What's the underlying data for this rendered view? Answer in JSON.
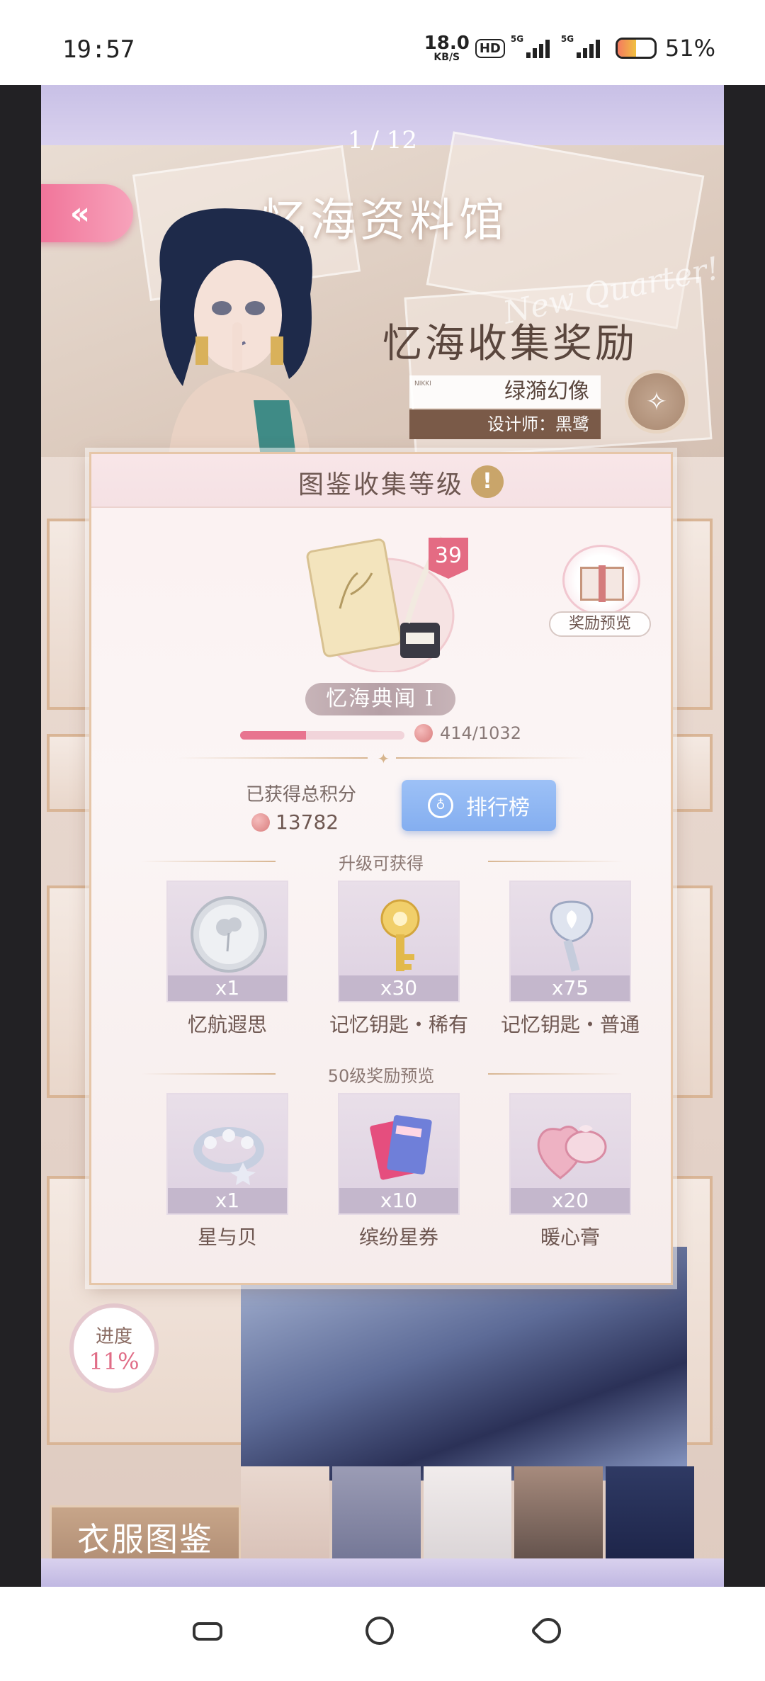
{
  "status_bar": {
    "time": "19:57",
    "net_speed_value": "18.0",
    "net_speed_unit": "KB/S",
    "hd_label": "HD",
    "sig1_label": "5G",
    "sig2_label": "5G",
    "battery_percent": "51%",
    "battery_level": 0.51
  },
  "game": {
    "page_indicator": "1 / 12",
    "back_icon": "double-chevron-left-icon",
    "title": "忆海资料馆",
    "banner": {
      "watermark": "New Quarter!",
      "title": "忆海收集奖励",
      "outfit_tag": "NIKKI",
      "outfit_name": "绿漪幻像",
      "designer": "设计师：黑鹭"
    },
    "background_cards": {
      "card_label": "衣服图鉴",
      "progress_label": "进度",
      "progress_value": "11%",
      "progress_level": 0.11
    }
  },
  "modal": {
    "title": "图鉴收集等级",
    "info_icon": "!",
    "level": "39",
    "reward_preview_label": "奖励预览",
    "rank_name": "忆海典闻 I",
    "exp_text": "414/1032",
    "exp_current": 414,
    "exp_max": 1032,
    "total_label": "已获得总积分",
    "total_value": "13782",
    "ranking_button": "排行榜",
    "upgrade_section_title": "升级可获得",
    "upgrade_items": [
      {
        "count": "x1",
        "name": "忆航遐思"
      },
      {
        "count": "x30",
        "name": "记忆钥匙・稀有"
      },
      {
        "count": "x75",
        "name": "记忆钥匙・普通"
      }
    ],
    "level50_section_title": "50级奖励预览",
    "level50_items": [
      {
        "count": "x1",
        "name": "星与贝"
      },
      {
        "count": "x10",
        "name": "缤纷星券"
      },
      {
        "count": "x20",
        "name": "暖心膏"
      }
    ]
  },
  "colors": {
    "accent_pink": "#e8748f",
    "ranking_blue": "#84aef0",
    "gold": "#c9a56a"
  }
}
